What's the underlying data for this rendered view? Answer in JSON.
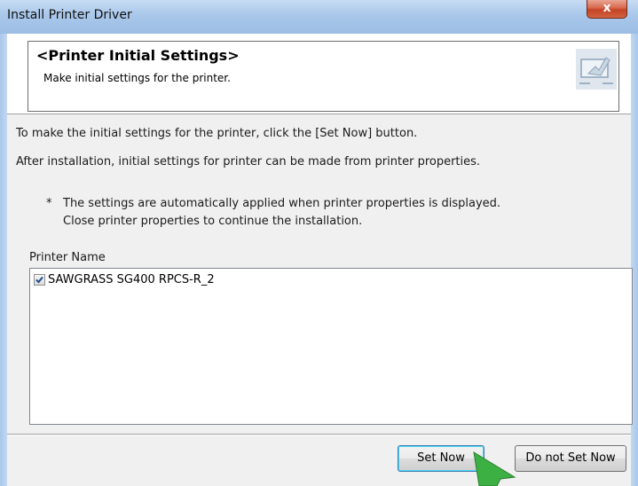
{
  "window": {
    "title": "Install Printer Driver",
    "close_label": "x"
  },
  "header": {
    "title": "<Printer Initial Settings>",
    "subtitle": "Make initial settings for the printer.",
    "icon": "settings-monitor-icon"
  },
  "content": {
    "line1": "To make the initial settings for the printer, click the [Set Now] button.",
    "line2": "After installation, initial settings for printer can be made from printer properties.",
    "note_marker": "*",
    "note_line1": "The settings are automatically applied when printer properties is displayed.",
    "note_line2": "Close printer properties to continue the installation.",
    "printer_label": "Printer Name",
    "printers": [
      {
        "name": "SAWGRASS SG400 RPCS-R_2",
        "checked": true
      }
    ]
  },
  "buttons": {
    "set_now": "Set Now",
    "not_set_now": "Do not Set Now"
  },
  "colors": {
    "title_bar": "#a9c7ea",
    "close_button": "#c44426",
    "pointer_arrow": "#3cb043"
  }
}
